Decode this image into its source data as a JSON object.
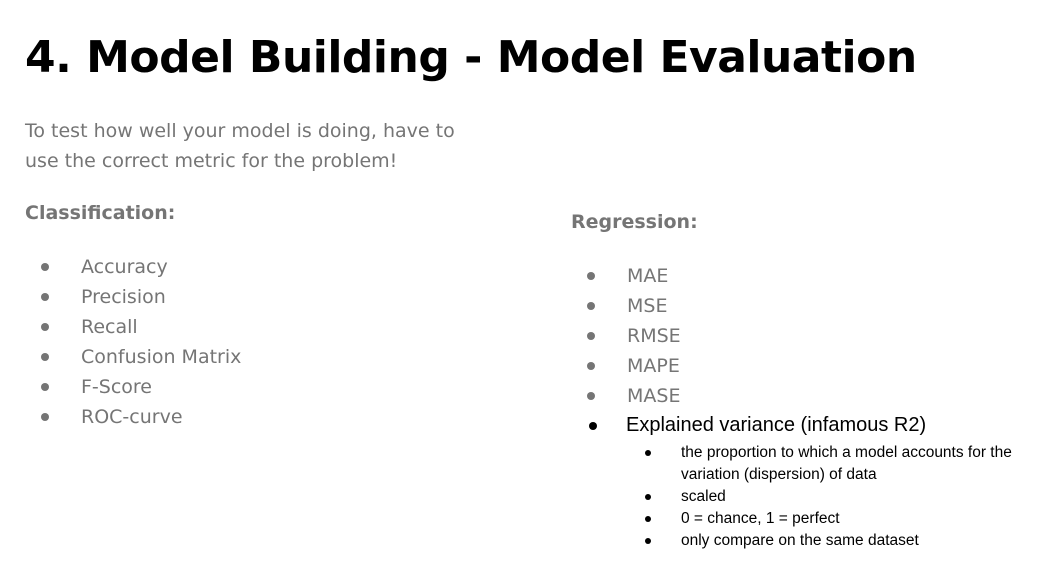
{
  "title": "4. Model Building - Model Evaluation",
  "subtitle": "To test how well your model is doing, have to use the correct metric for the problem!",
  "classification": {
    "heading": "Classification:",
    "items": [
      "Accuracy",
      "Precision",
      "Recall",
      "Confusion Matrix",
      "F-Score",
      "ROC-curve"
    ]
  },
  "regression": {
    "heading": "Regression:",
    "items": [
      "MAE",
      "MSE",
      "RMSE",
      "MAPE",
      "MASE"
    ],
    "explained": {
      "label": "Explained variance (infamous R2)",
      "subitems": [
        "the proportion to which a model accounts for the variation (dispersion) of data",
        "scaled",
        "0 = chance, 1 = perfect",
        "only compare on the same dataset"
      ]
    }
  }
}
